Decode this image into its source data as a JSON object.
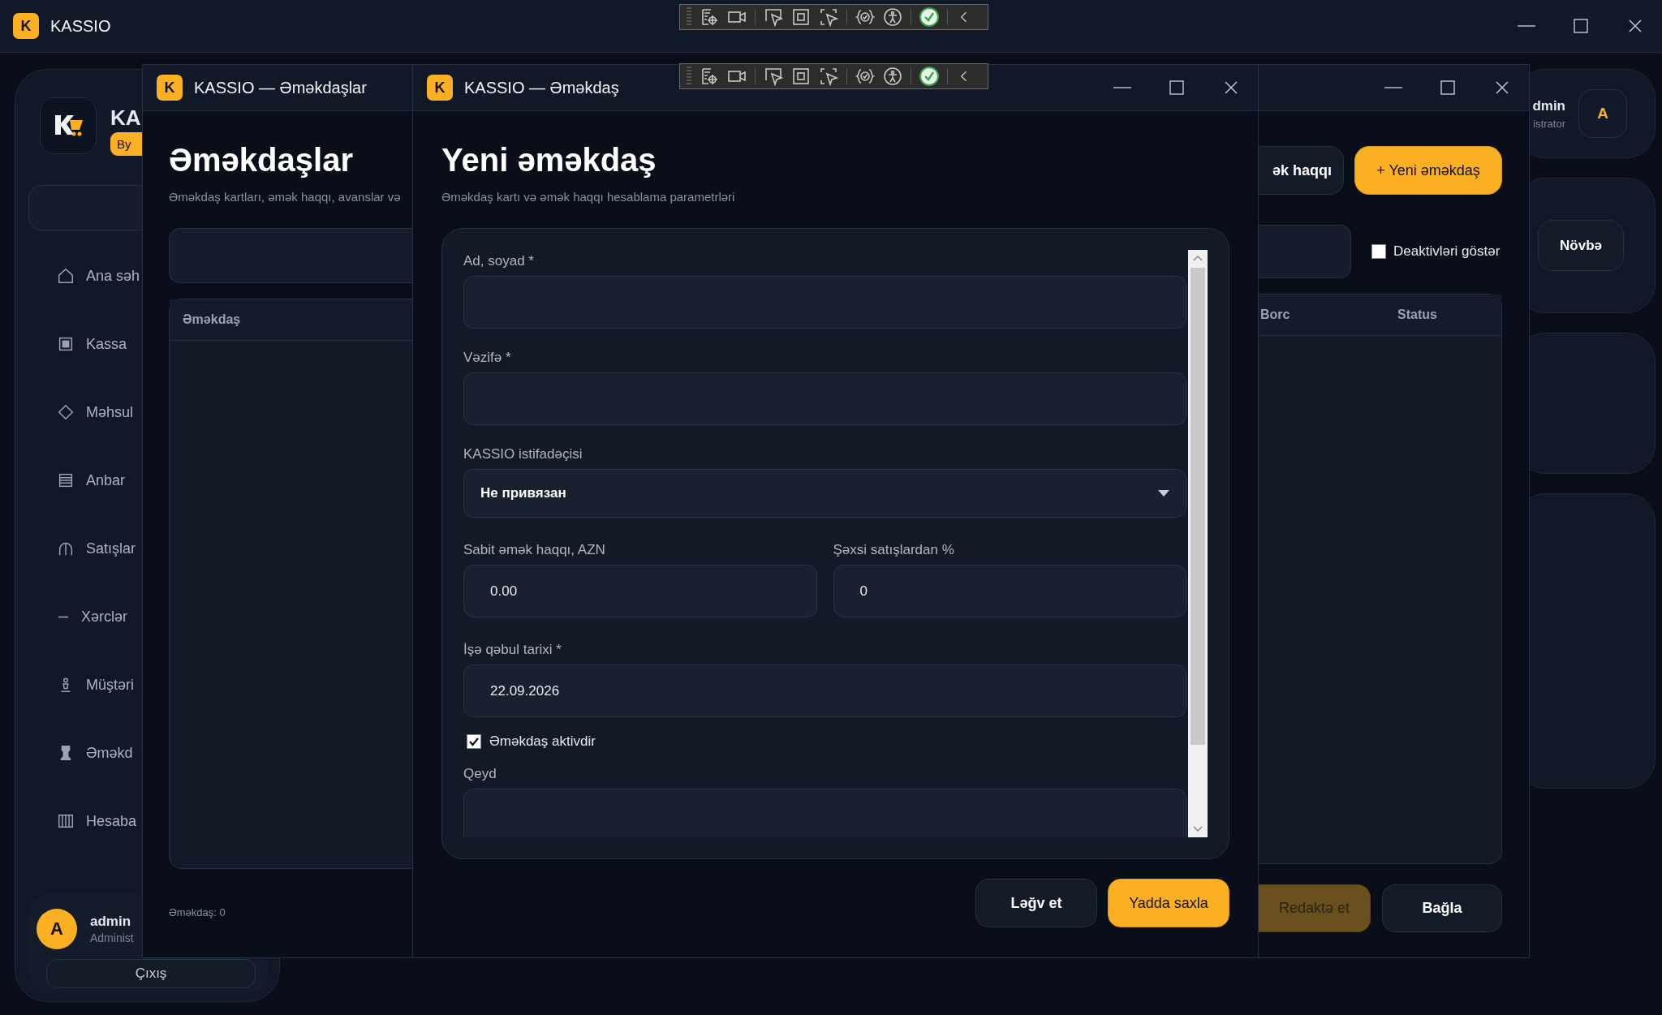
{
  "main_window": {
    "app_icon": "K",
    "title": "KASSIO",
    "sidebar": {
      "brand": "KA",
      "badge": "By",
      "items": [
        {
          "label": "Ana səh"
        },
        {
          "label": "Kassa"
        },
        {
          "label": "Məhsul"
        },
        {
          "label": "Anbar"
        },
        {
          "label": "Satışlar"
        },
        {
          "label": "Xərclər"
        },
        {
          "label": "Müştəri"
        },
        {
          "label": "Əməkd"
        },
        {
          "label": "Hesaba"
        }
      ],
      "user": {
        "avatar": "A",
        "name": "admin",
        "role": "Administ"
      },
      "logout": "Çıxış"
    },
    "header_user": {
      "name": "dmin",
      "role": "istrator",
      "avatar": "A"
    },
    "shift_button": "Növbə"
  },
  "list_window": {
    "app_icon": "K",
    "title": "KASSIO — Əməkdaşlar",
    "heading": "Əməkdaşlar",
    "subtitle": "Əməkdaş kartları, əmək haqqı, avanslar və",
    "salary_button": "ək haqqı",
    "new_button": "+ Yeni əməkdaş",
    "show_inactive": {
      "label": "Deaktivləri göstər",
      "checked": false
    },
    "table": {
      "columns": [
        "Əməkdaş",
        "Borc",
        "Status"
      ]
    },
    "footer": "Əməkdaş: 0",
    "edit_button": {
      "label": "Redaktə et",
      "disabled": true
    },
    "close_button": "Bağla"
  },
  "dialog": {
    "app_icon": "K",
    "title": "KASSIO — Əməkdaş",
    "heading": "Yeni əməkdaş",
    "subtitle": "Əməkdaş kartı və əmək haqqı hesablama parametrləri",
    "fields": [
      {
        "kind": "text",
        "label": "Ad, soyad *"
      },
      {
        "kind": "text",
        "label": "Vəzifə *"
      },
      {
        "kind": "select",
        "label": "KASSIO istifadəçisi",
        "value": "Не привязан"
      },
      {
        "kind": "row",
        "fields": [
          {
            "kind": "text",
            "label": "Sabit əmək haqqı, AZN",
            "value": "0.00"
          },
          {
            "kind": "text",
            "label": "Şəxsi satışlardan %",
            "value": "0"
          }
        ]
      },
      {
        "kind": "text",
        "label": "İşə qəbul tarixi *",
        "value": "22.09.2026"
      },
      {
        "kind": "checkbox",
        "label": "Əməkdaş aktivdir",
        "checked": true
      },
      {
        "kind": "textarea",
        "label": "Qeyd"
      }
    ],
    "buttons": [
      {
        "kind": "secondary",
        "label": "Ləğv et"
      },
      {
        "kind": "primary",
        "label": "Yadda saxla"
      }
    ]
  }
}
